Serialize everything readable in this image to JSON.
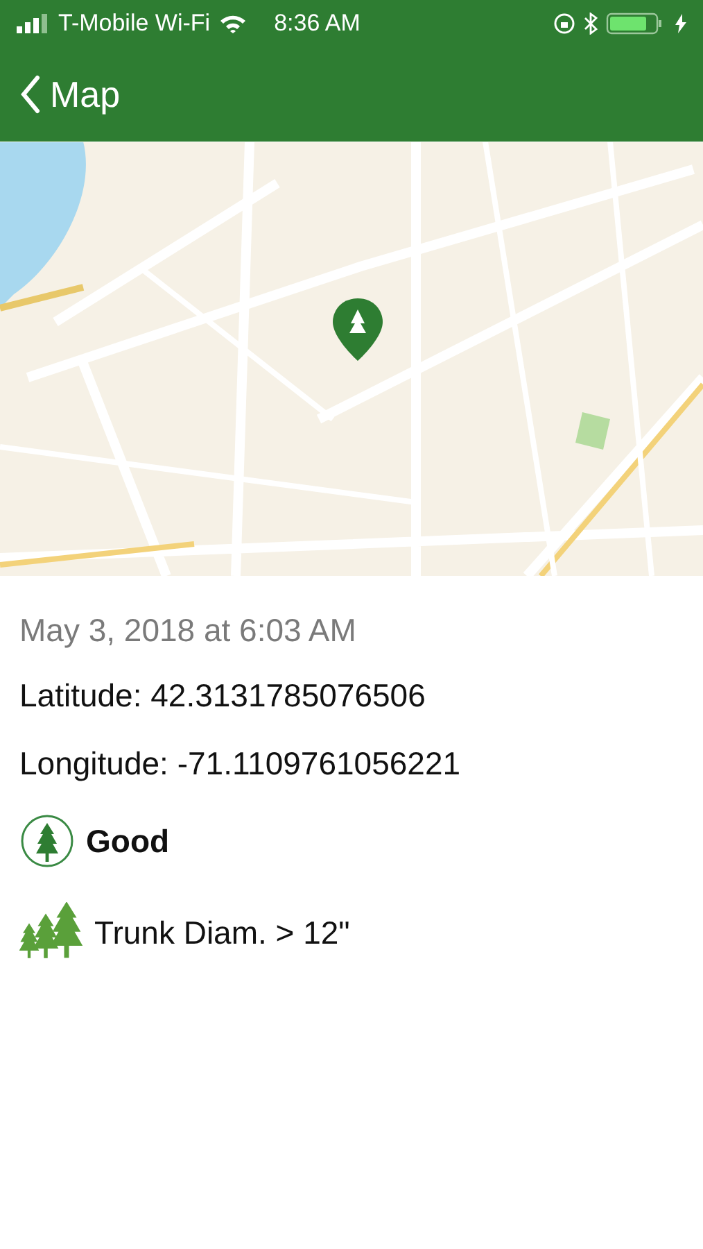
{
  "status_bar": {
    "carrier": "T-Mobile Wi-Fi",
    "time": "8:36 AM"
  },
  "nav": {
    "back_label": "Map"
  },
  "details": {
    "date": "May 3, 2018 at 6:03 AM",
    "latitude": "Latitude: 42.3131785076506",
    "longitude": "Longitude: -71.1109761056221"
  },
  "attributes": [
    {
      "kind": "health",
      "label": "Good"
    },
    {
      "kind": "size",
      "label": "Trunk Diam. > 12\""
    }
  ]
}
